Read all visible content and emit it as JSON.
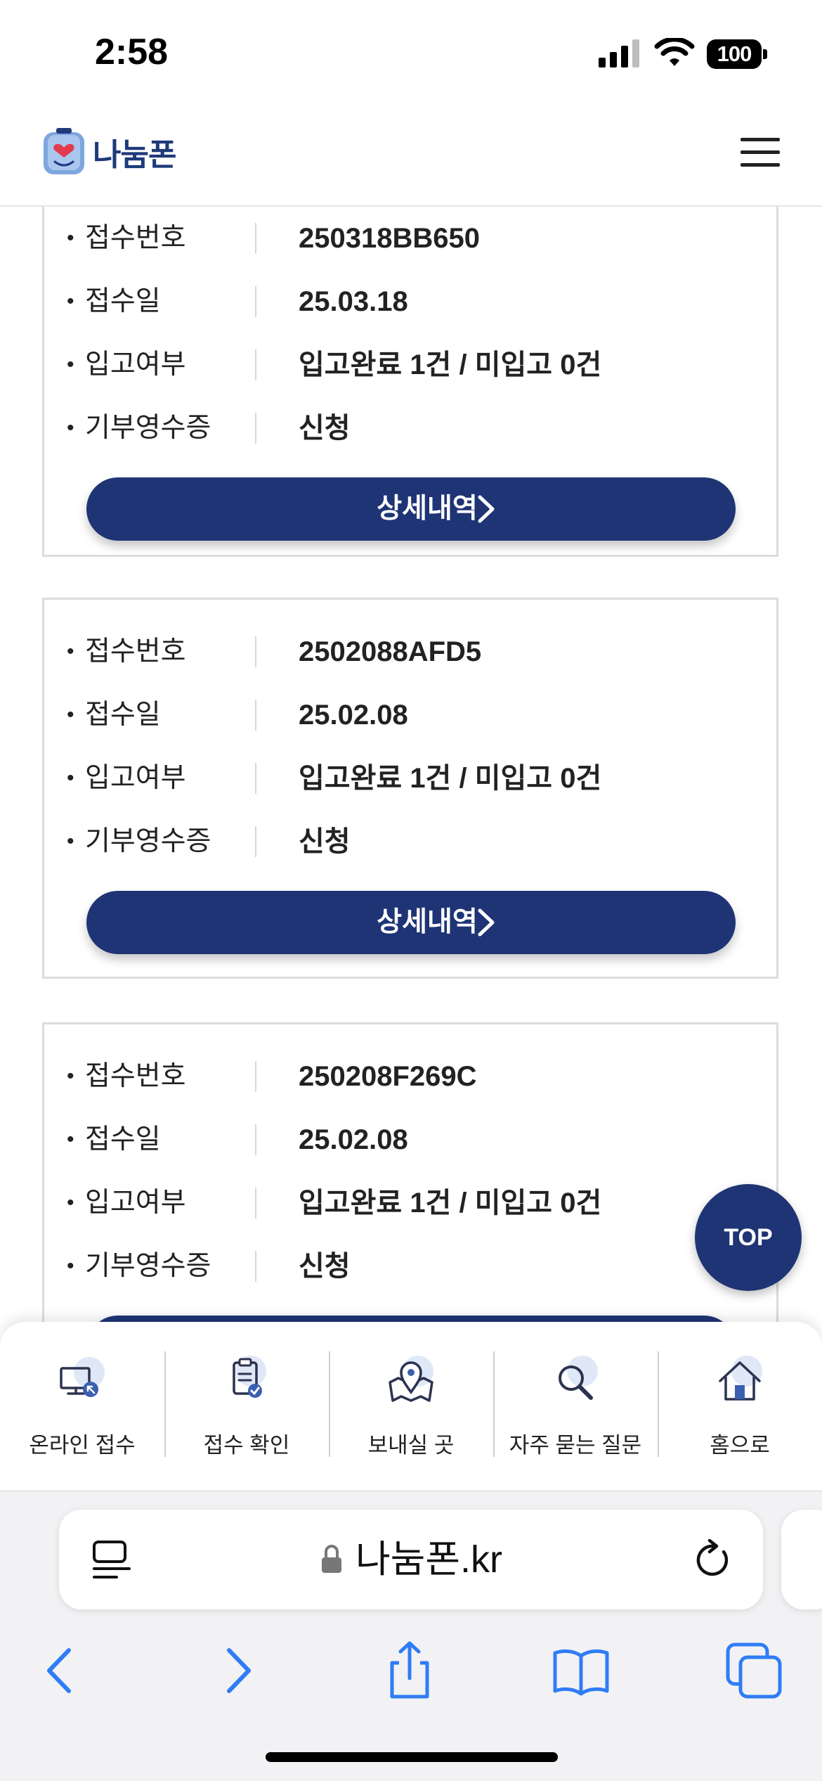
{
  "status_bar": {
    "time": "2:58",
    "battery": "100"
  },
  "header": {
    "logo_text": "나눔폰",
    "logo_icon": "heart-phone-mascot-icon",
    "menu_icon": "hamburger-menu-icon"
  },
  "labels": {
    "receipt_no": "접수번호",
    "receipt_date": "접수일",
    "stock_status": "입고여부",
    "donation_receipt": "기부영수증",
    "detail_button": "상세내역"
  },
  "receipts": [
    {
      "receipt_no": "250318BB650",
      "receipt_date": "25.03.18",
      "stock_status": "입고완료 1건 / 미입고 0건",
      "donation_receipt": "신청"
    },
    {
      "receipt_no": "2502088AFD5",
      "receipt_date": "25.02.08",
      "stock_status": "입고완료 1건 / 미입고 0건",
      "donation_receipt": "신청"
    },
    {
      "receipt_no": "250208F269C",
      "receipt_date": "25.02.08",
      "stock_status": "입고완료 1건 / 미입고 0건",
      "donation_receipt": "신청"
    }
  ],
  "top_button": "TOP",
  "quick_nav": [
    {
      "label": "온라인 접수",
      "icon": "computer-cursor-icon"
    },
    {
      "label": "접수 확인",
      "icon": "clipboard-check-icon"
    },
    {
      "label": "보내실 곳",
      "icon": "map-pin-icon"
    },
    {
      "label": "자주 묻는 질문",
      "icon": "magnifier-icon"
    },
    {
      "label": "홈으로",
      "icon": "home-icon"
    }
  ],
  "browser": {
    "url": "나눔폰.kr",
    "accent_color": "#2f7cf6"
  },
  "colors": {
    "brand_navy": "#1e3475",
    "border": "#dcdcdc"
  }
}
